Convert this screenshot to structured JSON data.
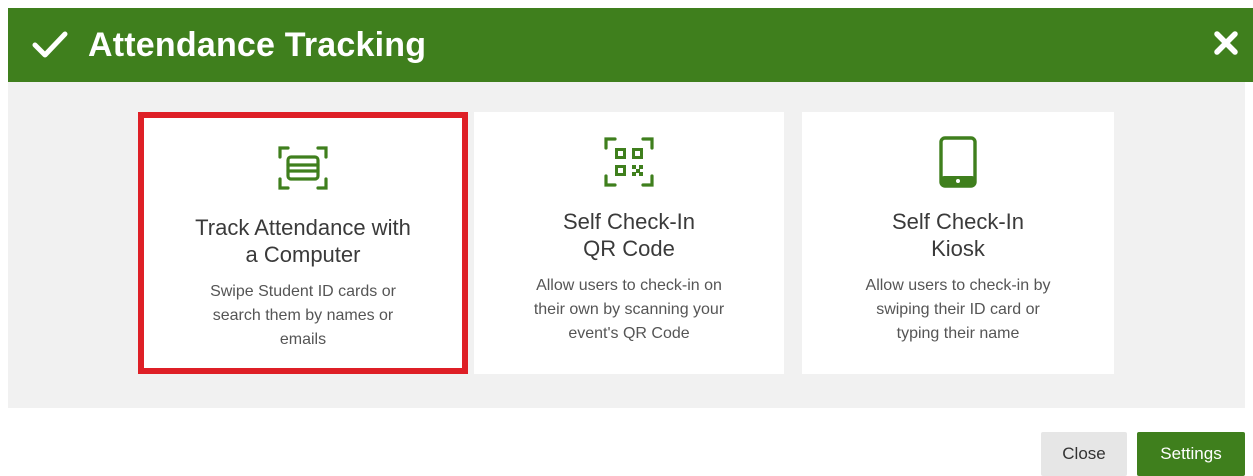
{
  "header": {
    "title": "Attendance Tracking",
    "check_icon": "checkmark-icon",
    "close_icon": "close-icon"
  },
  "options": [
    {
      "icon": "id-card-scan-icon",
      "title_line1": "Track Attendance with",
      "title_line2": "a Computer",
      "description_line1": "Swipe Student ID cards or",
      "description_line2": "search them by names or",
      "description_line3": "emails",
      "selected": true
    },
    {
      "icon": "qr-code-icon",
      "title_line1": "Self Check-In",
      "title_line2": "QR Code",
      "description_line1": "Allow users to check-in on",
      "description_line2": "their own by scanning your",
      "description_line3": "event's QR Code",
      "selected": false
    },
    {
      "icon": "tablet-icon",
      "title_line1": "Self Check-In",
      "title_line2": "Kiosk",
      "description_line1": "Allow users to check-in by",
      "description_line2": "swiping their ID card or",
      "description_line3": "typing their name",
      "selected": false
    }
  ],
  "footer": {
    "close_label": "Close",
    "settings_label": "Settings"
  },
  "colors": {
    "brand_green": "#3f7f1d",
    "selection_red": "#de1f26",
    "panel_bg": "#f1f1f1"
  }
}
